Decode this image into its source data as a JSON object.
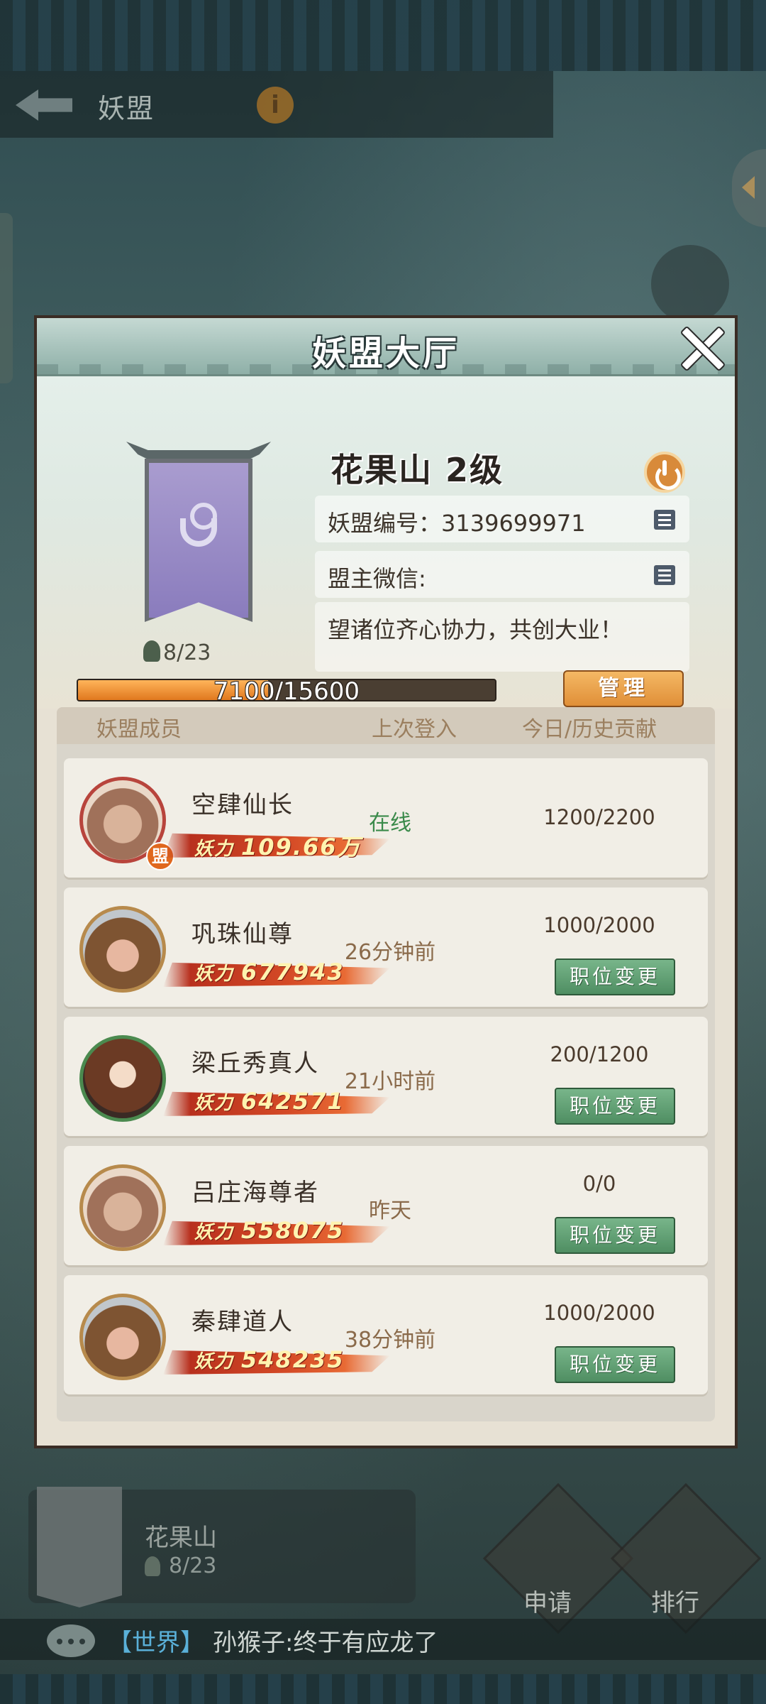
{
  "screen": {
    "title": "妖盟",
    "info_glyph": "i"
  },
  "dialog": {
    "title": "妖盟大厅",
    "guild": {
      "name": "花果山 2级",
      "member_count": "8/23",
      "id_label": "妖盟编号：3139699971",
      "wechat_label": "盟主微信:",
      "notice": "望诸位齐心协力，共创大业！",
      "exp_text": "7100/15600",
      "exp_fraction": 0.455,
      "manage_label": "管理"
    },
    "columns": {
      "members": "妖盟成员",
      "last_login": "上次登入",
      "contribution": "今日/历史贡献"
    },
    "members": [
      {
        "name": "空肆仙长",
        "power_label": "妖力",
        "power": "109.66万",
        "login": "在线",
        "contribution": "1200/2200",
        "badge": "盟",
        "role_button": ""
      },
      {
        "name": "巩珠仙尊",
        "power_label": "妖力",
        "power": "677943",
        "login": "26分钟前",
        "contribution": "1000/2000",
        "badge": "",
        "role_button": "职位变更"
      },
      {
        "name": "梁丘秀真人",
        "power_label": "妖力",
        "power": "642571",
        "login": "21小时前",
        "contribution": "200/1200",
        "badge": "",
        "role_button": "职位变更"
      },
      {
        "name": "吕庄海尊者",
        "power_label": "妖力",
        "power": "558075",
        "login": "昨天",
        "contribution": "0/0",
        "badge": "",
        "role_button": "职位变更"
      },
      {
        "name": "秦肆道人",
        "power_label": "妖力",
        "power": "548235",
        "login": "38分钟前",
        "contribution": "1000/2000",
        "badge": "",
        "role_button": "职位变更"
      }
    ]
  },
  "background": {
    "guild_name": "花果山",
    "member_count": "8/23",
    "apply_label": "申请",
    "rank_label": "排行"
  },
  "chat": {
    "channel": "【世界】",
    "message": "孙猴子:终于有应龙了"
  },
  "colors": {
    "exp_fill": "#e0781e",
    "online": "#3a8a4a",
    "role_button": "#4f8e62",
    "manage_button": "#e08f38"
  }
}
